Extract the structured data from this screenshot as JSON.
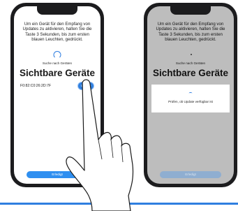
{
  "left_screen": {
    "instruction": "Um ein Gerät für den Empfang von Updates zu aktivieren, halten Sie die Taste 3 Sekunden, bis zum ersten blauen Leuchten, gedrückt.",
    "searching_label": "Suche nach Geräten",
    "title": "Sichtbare Geräte",
    "device_id": "F0:82:C0:26:2D:7F",
    "update_button": "Update",
    "done_button": "Erledigt"
  },
  "right_screen": {
    "instruction": "Um ein Gerät für den Empfang von Updates zu aktivieren, halten Sie die Taste 3 Sekunden, bis zum ersten blauen Leuchten, gedrückt.",
    "searching_label": "Suche nach Geräten",
    "title": "Sichtbare Geräte",
    "dialog_text": "Prüfen, ob Update verfügbar ist",
    "done_button": "Erledigt"
  },
  "colors": {
    "accent": "#2f7fe0",
    "phone_frame": "#1c1c1e",
    "overlay_gray": "#bdbdbd"
  },
  "icons": [
    "spinner-icon",
    "hand-pointer-icon"
  ]
}
